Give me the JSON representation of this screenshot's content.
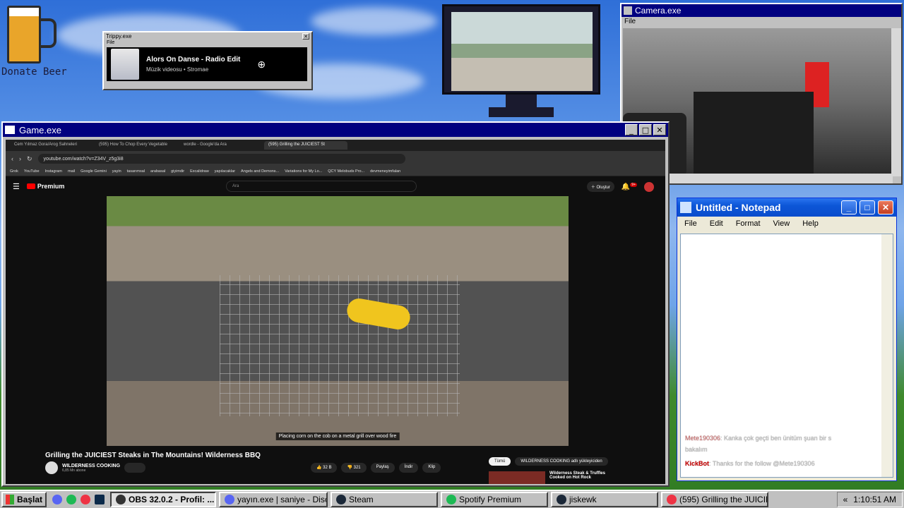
{
  "desktop": {
    "donate_label": "Donate Beer"
  },
  "trippy": {
    "title": "Trippy.exe",
    "menu": "File",
    "song": "Alors On Danse - Radio Edit",
    "subtitle": "Müzik videosu • Stromae"
  },
  "camera": {
    "title": "Camera.exe",
    "menu": "File"
  },
  "game": {
    "title": "Game.exe",
    "tabs": [
      "Cem Yılmaz Gora/Arog Sahneleri",
      "(595) How To Chop Every Vegetable",
      "wordle - Google'da Ara",
      "(595) Grilling the JUICIEST St"
    ],
    "url": "youtube.com/watch?v=Z34V_z5g3i8",
    "bookmarks": [
      "Grok",
      "YouTube",
      "Instagram",
      "mail",
      "Google Gemini",
      "yayin",
      "tasarımsal",
      "arabasal",
      "giyimdir",
      "Excalidraw",
      "yapılacaklar",
      "Angels and Demons...",
      "Variations for My Lo...",
      "QCY Melobuds Pro...",
      "devmeneyimfalan"
    ],
    "youtube": {
      "logo": "Premium",
      "search_placeholder": "Ara",
      "create": "Oluştur",
      "notif_count": "9+",
      "caption": "Placing corn on the cob on a metal grill over wood fire",
      "video_title": "Grilling the JUICIEST Steaks in The Mountains! Wilderness BBQ",
      "channel": "WILDERNESS COOKING",
      "subs": "6,85 Mn abone",
      "likes": "32 B",
      "dislikes": "321",
      "share": "Paylaş",
      "download": "İndir",
      "clip": "Klip",
      "chip_all": "Tümü",
      "chip_channel": "WILDERNESS COOKING adlı yükleyiciden",
      "side_title": "Wilderness Steak & Truffles Cooked on Hot Rock"
    }
  },
  "notepad": {
    "title": "Untitled - Notepad",
    "menu": [
      "File",
      "Edit",
      "Format",
      "View",
      "Help"
    ],
    "chat": [
      {
        "user": "Mete190306",
        "text": ": Kanka çok geçti ben ünitüm şuan bir s"
      },
      {
        "user": "",
        "text": "bakalım"
      },
      {
        "user": "KickBot",
        "text": ": Thanks for the follow @Mete190306"
      }
    ]
  },
  "taskbar": {
    "start": "Başlat",
    "tasks": [
      "OBS 32.0.2 - Profil: ...",
      "yayın.exe | saniye - Disc...",
      "Steam",
      "Spotify Premium",
      "jiskewk",
      "(595) Grilling the JUICIE..."
    ],
    "time": "1:10:51 AM"
  }
}
